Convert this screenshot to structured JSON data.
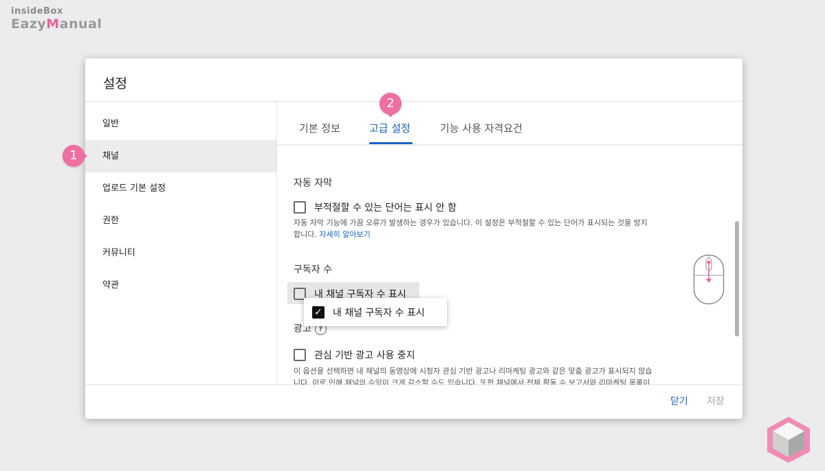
{
  "brand": {
    "top": "insideBox",
    "bottom_prefix": "Eazy",
    "bottom_pink": "M",
    "bottom_suffix": "anual"
  },
  "dialog": {
    "title": "설정"
  },
  "sidebar": {
    "items": [
      {
        "label": "일반"
      },
      {
        "label": "채널"
      },
      {
        "label": "업로드 기본 설정"
      },
      {
        "label": "권한"
      },
      {
        "label": "커뮤니티"
      },
      {
        "label": "약관"
      }
    ],
    "active_index": 1
  },
  "tabs": [
    {
      "label": "기본 정보"
    },
    {
      "label": "고급 설정"
    },
    {
      "label": "기능 사용 자격요건"
    }
  ],
  "active_tab": 1,
  "sections": {
    "captions": {
      "title": "자동 자막",
      "checkbox_label": "부적절할 수 있는 단어는 표시 안 함",
      "checked": false,
      "desc_line1": "자동 자막 기능에 가끔 오류가 발생하는 경우가 있습니다. 이 설정은 부적절할 수 있는 단어가 표시되는 것을 방지",
      "desc_line2": "합니다.",
      "learn_more": "자세히 알아보기"
    },
    "subscribers": {
      "title": "구독자 수",
      "checkbox_label": "내 채널 구독자 수 표시",
      "checked": false
    },
    "ads": {
      "title": "광고",
      "checkbox_label": "관심 기반 광고 사용 중지",
      "checked": false,
      "desc_line1": "이 옵션을 선택하면 내 채널의 동영상에 시청자 관심 기반 광고나 리마케팅 광고와 같은 맞춤 광고가 표시되지 않습",
      "desc_line2": "니다. 이로 인해 채널의 수익이 크게 감소할 수도 있습니다. 또한 채널에서 전체 활동 수 보고서와 리마케팅 목록이"
    }
  },
  "popup": {
    "label": "내 채널 구독자 수 표시",
    "checked": true
  },
  "footer": {
    "close_label": "닫기",
    "save_label": "저장"
  },
  "annotations": {
    "badge1": "1",
    "badge2": "2"
  },
  "colors": {
    "accent": "#1a63c6",
    "badge": "#ee6fa2"
  }
}
